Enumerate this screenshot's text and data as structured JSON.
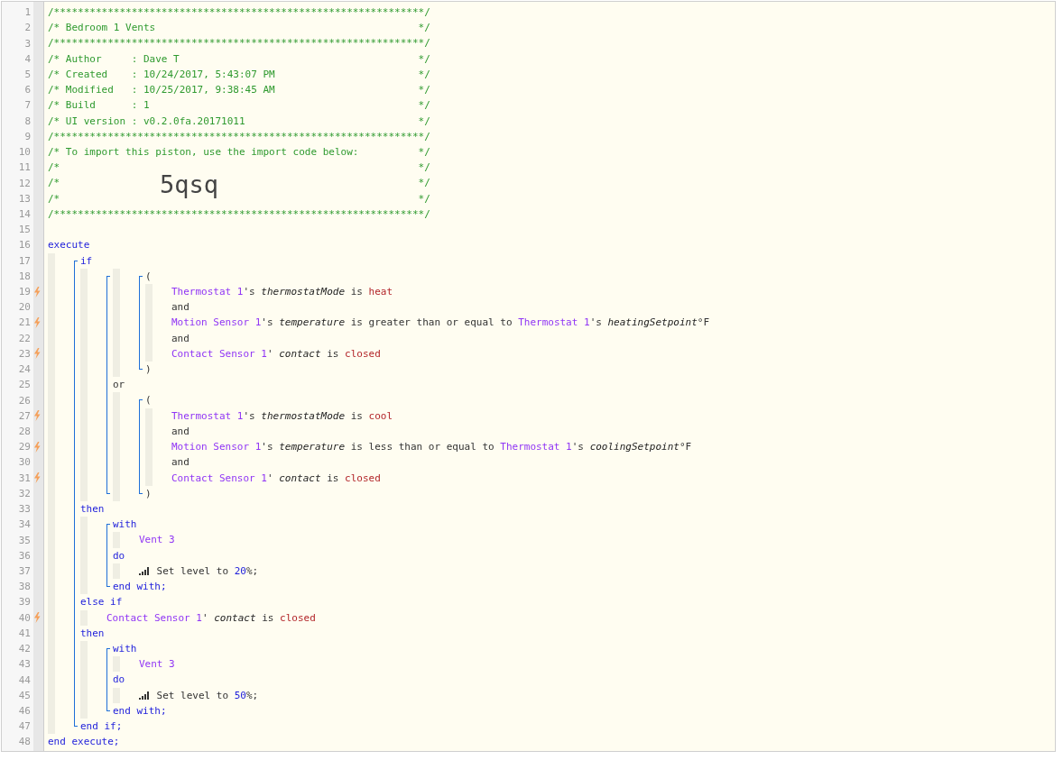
{
  "gutter": [
    {
      "number": "1",
      "trigger": false
    },
    {
      "number": "2",
      "trigger": false
    },
    {
      "number": "3",
      "trigger": false
    },
    {
      "number": "4",
      "trigger": false
    },
    {
      "number": "5",
      "trigger": false
    },
    {
      "number": "6",
      "trigger": false
    },
    {
      "number": "7",
      "trigger": false
    },
    {
      "number": "8",
      "trigger": false
    },
    {
      "number": "9",
      "trigger": false
    },
    {
      "number": "10",
      "trigger": false
    },
    {
      "number": "11",
      "trigger": false
    },
    {
      "number": "12",
      "trigger": false
    },
    {
      "number": "13",
      "trigger": false
    },
    {
      "number": "14",
      "trigger": false
    },
    {
      "number": "15",
      "trigger": false
    },
    {
      "number": "16",
      "trigger": false
    },
    {
      "number": "17",
      "trigger": false
    },
    {
      "number": "18",
      "trigger": false
    },
    {
      "number": "19",
      "trigger": true
    },
    {
      "number": "20",
      "trigger": false
    },
    {
      "number": "21",
      "trigger": true
    },
    {
      "number": "22",
      "trigger": false
    },
    {
      "number": "23",
      "trigger": true
    },
    {
      "number": "24",
      "trigger": false
    },
    {
      "number": "25",
      "trigger": false
    },
    {
      "number": "26",
      "trigger": false
    },
    {
      "number": "27",
      "trigger": true
    },
    {
      "number": "28",
      "trigger": false
    },
    {
      "number": "29",
      "trigger": true
    },
    {
      "number": "30",
      "trigger": false
    },
    {
      "number": "31",
      "trigger": true
    },
    {
      "number": "32",
      "trigger": false
    },
    {
      "number": "33",
      "trigger": false
    },
    {
      "number": "34",
      "trigger": false
    },
    {
      "number": "35",
      "trigger": false
    },
    {
      "number": "36",
      "trigger": false
    },
    {
      "number": "37",
      "trigger": false
    },
    {
      "number": "38",
      "trigger": false
    },
    {
      "number": "39",
      "trigger": false
    },
    {
      "number": "40",
      "trigger": true
    },
    {
      "number": "41",
      "trigger": false
    },
    {
      "number": "42",
      "trigger": false
    },
    {
      "number": "43",
      "trigger": false
    },
    {
      "number": "44",
      "trigger": false
    },
    {
      "number": "45",
      "trigger": false
    },
    {
      "number": "46",
      "trigger": false
    },
    {
      "number": "47",
      "trigger": false
    },
    {
      "number": "48",
      "trigger": false
    }
  ],
  "code": [
    {
      "kind": "line",
      "tokens": [
        {
          "kind": "comment",
          "text": "/**************************************************************/"
        }
      ]
    },
    {
      "kind": "line",
      "tokens": [
        {
          "kind": "comment",
          "text": "/* Bedroom 1 Vents"
        },
        {
          "kind": "comment-end",
          "text": "*/"
        }
      ]
    },
    {
      "kind": "line",
      "tokens": [
        {
          "kind": "comment",
          "text": "/**************************************************************/"
        }
      ]
    },
    {
      "kind": "line",
      "tokens": [
        {
          "kind": "comment",
          "text": "/* Author     : Dave T"
        },
        {
          "kind": "comment-end",
          "text": "*/"
        }
      ]
    },
    {
      "kind": "line",
      "tokens": [
        {
          "kind": "comment",
          "text": "/* Created    : 10/24/2017, 5:43:07 PM"
        },
        {
          "kind": "comment-end",
          "text": "*/"
        }
      ]
    },
    {
      "kind": "line",
      "tokens": [
        {
          "kind": "comment",
          "text": "/* Modified   : 10/25/2017, 9:38:45 AM"
        },
        {
          "kind": "comment-end",
          "text": "*/"
        }
      ]
    },
    {
      "kind": "line",
      "tokens": [
        {
          "kind": "comment",
          "text": "/* Build      : 1"
        },
        {
          "kind": "comment-end",
          "text": "*/"
        }
      ]
    },
    {
      "kind": "line",
      "tokens": [
        {
          "kind": "comment",
          "text": "/* UI version : v0.2.0fa.20171011"
        },
        {
          "kind": "comment-end",
          "text": "*/"
        }
      ]
    },
    {
      "kind": "line",
      "tokens": [
        {
          "kind": "comment",
          "text": "/**************************************************************/"
        }
      ]
    },
    {
      "kind": "line",
      "tokens": [
        {
          "kind": "comment",
          "text": "/* To import this piston, use the import code below:"
        },
        {
          "kind": "comment-end",
          "text": "*/"
        }
      ]
    },
    {
      "kind": "line",
      "tokens": [
        {
          "kind": "comment",
          "text": "/*"
        },
        {
          "kind": "comment-end",
          "text": "*/"
        }
      ]
    },
    {
      "kind": "line",
      "tokens": [
        {
          "kind": "comment",
          "text": "/*"
        },
        {
          "kind": "import-code",
          "text": "5qsq"
        },
        {
          "kind": "comment-end",
          "text": "*/"
        }
      ]
    },
    {
      "kind": "line",
      "tokens": [
        {
          "kind": "comment",
          "text": "/*"
        },
        {
          "kind": "comment-end",
          "text": "*/"
        }
      ]
    },
    {
      "kind": "line",
      "tokens": [
        {
          "kind": "comment",
          "text": "/**************************************************************/"
        }
      ]
    },
    {
      "kind": "line"
    },
    {
      "kind": "line",
      "tokens": [
        {
          "kind": "keyword",
          "text": "execute"
        }
      ]
    },
    {
      "kind": "body",
      "items": [
        {
          "kind": "group",
          "items": [
            {
              "kind": "line",
              "tokens": [
                {
                  "kind": "keyword",
                  "text": "if"
                }
              ]
            },
            {
              "kind": "body",
              "items": [
                {
                  "kind": "group",
                  "items": [
                    {
                      "kind": "body",
                      "items": [
                        {
                          "kind": "group",
                          "items": [
                            {
                              "kind": "line",
                              "tokens": [
                                {
                                  "kind": "plain",
                                  "text": "("
                                }
                              ]
                            },
                            {
                              "kind": "body",
                              "items": [
                                {
                                  "kind": "line",
                                  "tokens": [
                                    {
                                      "kind": "device",
                                      "text": "Thermostat 1"
                                    },
                                    {
                                      "kind": "plain",
                                      "text": "'s "
                                    },
                                    {
                                      "kind": "attribute",
                                      "text": "thermostatMode"
                                    },
                                    {
                                      "kind": "plain",
                                      "text": " is "
                                    },
                                    {
                                      "kind": "value",
                                      "text": "heat"
                                    }
                                  ]
                                },
                                {
                                  "kind": "line",
                                  "tokens": [
                                    {
                                      "kind": "plain",
                                      "text": "and"
                                    }
                                  ]
                                },
                                {
                                  "kind": "line",
                                  "tokens": [
                                    {
                                      "kind": "device",
                                      "text": "Motion Sensor 1"
                                    },
                                    {
                                      "kind": "plain",
                                      "text": "'s "
                                    },
                                    {
                                      "kind": "attribute",
                                      "text": "temperature"
                                    },
                                    {
                                      "kind": "plain",
                                      "text": " is greater than or equal to "
                                    },
                                    {
                                      "kind": "device",
                                      "text": "Thermostat 1"
                                    },
                                    {
                                      "kind": "plain",
                                      "text": "'s "
                                    },
                                    {
                                      "kind": "attribute",
                                      "text": "heatingSetpoint"
                                    },
                                    {
                                      "kind": "plain",
                                      "text": "°F"
                                    }
                                  ]
                                },
                                {
                                  "kind": "line",
                                  "tokens": [
                                    {
                                      "kind": "plain",
                                      "text": "and"
                                    }
                                  ]
                                },
                                {
                                  "kind": "line",
                                  "tokens": [
                                    {
                                      "kind": "device",
                                      "text": "Contact Sensor 1"
                                    },
                                    {
                                      "kind": "plain",
                                      "text": "' "
                                    },
                                    {
                                      "kind": "attribute",
                                      "text": "contact"
                                    },
                                    {
                                      "kind": "plain",
                                      "text": " is "
                                    },
                                    {
                                      "kind": "value",
                                      "text": "closed"
                                    }
                                  ]
                                }
                              ]
                            },
                            {
                              "kind": "line",
                              "tokens": [
                                {
                                  "kind": "plain",
                                  "text": ")"
                                }
                              ]
                            }
                          ]
                        }
                      ]
                    },
                    {
                      "kind": "line",
                      "tokens": [
                        {
                          "kind": "plain",
                          "text": "or"
                        }
                      ]
                    },
                    {
                      "kind": "body",
                      "items": [
                        {
                          "kind": "group",
                          "items": [
                            {
                              "kind": "line",
                              "tokens": [
                                {
                                  "kind": "plain",
                                  "text": "("
                                }
                              ]
                            },
                            {
                              "kind": "body",
                              "items": [
                                {
                                  "kind": "line",
                                  "tokens": [
                                    {
                                      "kind": "device",
                                      "text": "Thermostat 1"
                                    },
                                    {
                                      "kind": "plain",
                                      "text": "'s "
                                    },
                                    {
                                      "kind": "attribute",
                                      "text": "thermostatMode"
                                    },
                                    {
                                      "kind": "plain",
                                      "text": " is "
                                    },
                                    {
                                      "kind": "value",
                                      "text": "cool"
                                    }
                                  ]
                                },
                                {
                                  "kind": "line",
                                  "tokens": [
                                    {
                                      "kind": "plain",
                                      "text": "and"
                                    }
                                  ]
                                },
                                {
                                  "kind": "line",
                                  "tokens": [
                                    {
                                      "kind": "device",
                                      "text": "Motion Sensor 1"
                                    },
                                    {
                                      "kind": "plain",
                                      "text": "'s "
                                    },
                                    {
                                      "kind": "attribute",
                                      "text": "temperature"
                                    },
                                    {
                                      "kind": "plain",
                                      "text": " is less than or equal to "
                                    },
                                    {
                                      "kind": "device",
                                      "text": "Thermostat 1"
                                    },
                                    {
                                      "kind": "plain",
                                      "text": "'s "
                                    },
                                    {
                                      "kind": "attribute",
                                      "text": "coolingSetpoint"
                                    },
                                    {
                                      "kind": "plain",
                                      "text": "°F"
                                    }
                                  ]
                                },
                                {
                                  "kind": "line",
                                  "tokens": [
                                    {
                                      "kind": "plain",
                                      "text": "and"
                                    }
                                  ]
                                },
                                {
                                  "kind": "line",
                                  "tokens": [
                                    {
                                      "kind": "device",
                                      "text": "Contact Sensor 1"
                                    },
                                    {
                                      "kind": "plain",
                                      "text": "' "
                                    },
                                    {
                                      "kind": "attribute",
                                      "text": "contact"
                                    },
                                    {
                                      "kind": "plain",
                                      "text": " is "
                                    },
                                    {
                                      "kind": "value",
                                      "text": "closed"
                                    }
                                  ]
                                }
                              ]
                            },
                            {
                              "kind": "line",
                              "tokens": [
                                {
                                  "kind": "plain",
                                  "text": ")"
                                }
                              ]
                            }
                          ]
                        }
                      ]
                    }
                  ]
                }
              ]
            },
            {
              "kind": "line",
              "tokens": [
                {
                  "kind": "keyword",
                  "text": "then"
                }
              ]
            },
            {
              "kind": "body",
              "items": [
                {
                  "kind": "group",
                  "items": [
                    {
                      "kind": "line",
                      "tokens": [
                        {
                          "kind": "keyword",
                          "text": "with"
                        }
                      ]
                    },
                    {
                      "kind": "body",
                      "items": [
                        {
                          "kind": "line",
                          "tokens": [
                            {
                              "kind": "device",
                              "text": "Vent 3"
                            }
                          ]
                        }
                      ]
                    },
                    {
                      "kind": "line",
                      "tokens": [
                        {
                          "kind": "keyword",
                          "text": "do"
                        }
                      ]
                    },
                    {
                      "kind": "body",
                      "items": [
                        {
                          "kind": "line",
                          "tokens": [
                            {
                              "kind": "level-icon"
                            },
                            {
                              "kind": "plain",
                              "text": " Set level to "
                            },
                            {
                              "kind": "number",
                              "text": "20"
                            },
                            {
                              "kind": "plain",
                              "text": "%;"
                            }
                          ]
                        }
                      ]
                    },
                    {
                      "kind": "line",
                      "tokens": [
                        {
                          "kind": "keyword",
                          "text": "end with;"
                        }
                      ]
                    }
                  ]
                }
              ]
            },
            {
              "kind": "line",
              "tokens": [
                {
                  "kind": "keyword",
                  "text": "else if"
                }
              ]
            },
            {
              "kind": "body",
              "items": [
                {
                  "kind": "line",
                  "tokens": [
                    {
                      "kind": "device",
                      "text": "Contact Sensor 1"
                    },
                    {
                      "kind": "plain",
                      "text": "' "
                    },
                    {
                      "kind": "attribute",
                      "text": "contact"
                    },
                    {
                      "kind": "plain",
                      "text": " is "
                    },
                    {
                      "kind": "value",
                      "text": "closed"
                    }
                  ]
                }
              ]
            },
            {
              "kind": "line",
              "tokens": [
                {
                  "kind": "keyword",
                  "text": "then"
                }
              ]
            },
            {
              "kind": "body",
              "items": [
                {
                  "kind": "group",
                  "items": [
                    {
                      "kind": "line",
                      "tokens": [
                        {
                          "kind": "keyword",
                          "text": "with"
                        }
                      ]
                    },
                    {
                      "kind": "body",
                      "items": [
                        {
                          "kind": "line",
                          "tokens": [
                            {
                              "kind": "device",
                              "text": "Vent 3"
                            }
                          ]
                        }
                      ]
                    },
                    {
                      "kind": "line",
                      "tokens": [
                        {
                          "kind": "keyword",
                          "text": "do"
                        }
                      ]
                    },
                    {
                      "kind": "body",
                      "items": [
                        {
                          "kind": "line",
                          "tokens": [
                            {
                              "kind": "level-icon"
                            },
                            {
                              "kind": "plain",
                              "text": " Set level to "
                            },
                            {
                              "kind": "number",
                              "text": "50"
                            },
                            {
                              "kind": "plain",
                              "text": "%;"
                            }
                          ]
                        }
                      ]
                    },
                    {
                      "kind": "line",
                      "tokens": [
                        {
                          "kind": "keyword",
                          "text": "end with;"
                        }
                      ]
                    }
                  ]
                }
              ]
            },
            {
              "kind": "line",
              "tokens": [
                {
                  "kind": "keyword",
                  "text": "end if;"
                }
              ]
            }
          ]
        }
      ]
    },
    {
      "kind": "line",
      "tokens": [
        {
          "kind": "keyword",
          "text": "end execute;"
        }
      ]
    }
  ]
}
